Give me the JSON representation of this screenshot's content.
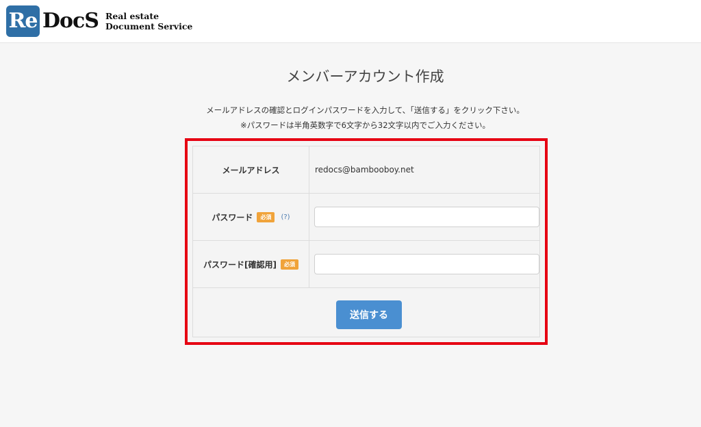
{
  "header": {
    "logo_re": "Re",
    "logo_docs": "DocS",
    "tagline_line1": "Real estate",
    "tagline_line2": "Document Service"
  },
  "page": {
    "title": "メンバーアカウント作成",
    "desc_line1": "メールアドレスの確認とログインパスワードを入力して、「送信する」をクリック下さい。",
    "desc_line2": "※パスワードは半角英数字で6文字から32文字以内でご入力ください。"
  },
  "form": {
    "email_label": "メールアドレス",
    "email_value": "redocs@bambooboy.net",
    "password_label": "パスワード",
    "password_required": "必須",
    "password_help": "(?)",
    "password_value": "",
    "confirm_label": "パスワード[確認用]",
    "confirm_required": "必須",
    "confirm_value": "",
    "submit_label": "送信する"
  },
  "colors": {
    "highlight_border": "#e60012",
    "button": "#4a8fd1",
    "badge": "#f0a33a",
    "logo_blue": "#2f6fa6"
  }
}
